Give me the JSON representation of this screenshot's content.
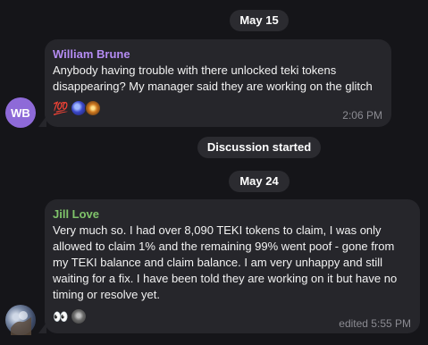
{
  "date_pills": [
    "May 15",
    "May 24"
  ],
  "service_message": "Discussion started",
  "messages": [
    {
      "avatar_initials": "WB",
      "avatar_color": "#8e6ad8",
      "sender": "William Brune",
      "sender_color": "#b48bf2",
      "text": "Anybody having trouble with there unlocked teki tokens disappearing? My manager said they are working on the glitch",
      "reactions": [
        "💯"
      ],
      "time": "2:06 PM"
    },
    {
      "avatar_initials": "",
      "sender": "Jill Love",
      "sender_color": "#7fc36a",
      "text": "Very much so.  I had over 8,090 TEKI tokens to claim, I was only allowed to claim 1% and the remaining 99% went poof - gone from my TEKI balance and claim balance.  I am very unhappy and still waiting for a fix. I have been told they are working on it but have no timing or resolve yet.",
      "reactions": [
        "👀"
      ],
      "time": "edited 5:55 PM"
    }
  ],
  "colors": {
    "background": "#151519",
    "bubble": "#26262b",
    "pill": "#2b2b30",
    "muted": "#8b8b92"
  }
}
